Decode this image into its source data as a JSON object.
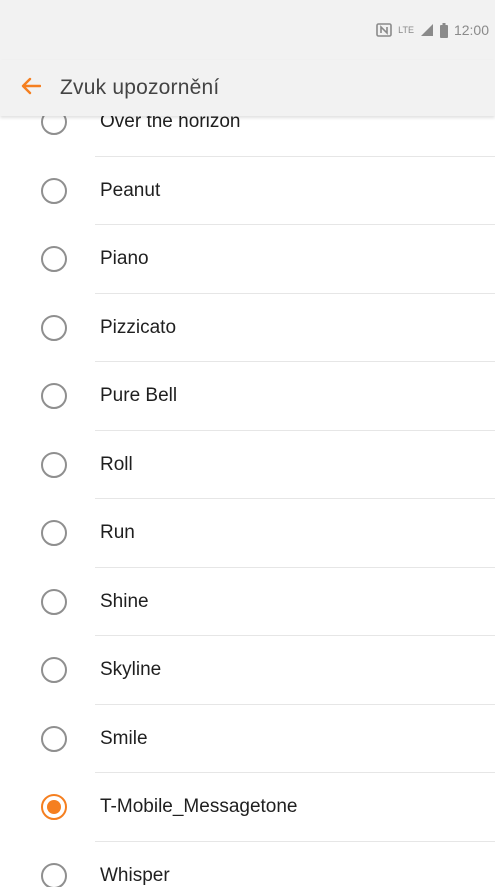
{
  "colors": {
    "accent": "#f57f20",
    "bar_background": "#f2f2f2",
    "radio_unchecked": "#8f8f8f"
  },
  "status_bar": {
    "nfc_icon": "nfc-icon",
    "network_label": "LTE",
    "signal_icon": "signal-icon",
    "battery_icon": "battery-icon",
    "time": "12:00"
  },
  "header": {
    "back_icon": "back-arrow-icon",
    "title": "Zvuk upozornění"
  },
  "list": {
    "items": [
      {
        "label": "Over the horizon",
        "selected": false
      },
      {
        "label": "Peanut",
        "selected": false
      },
      {
        "label": "Piano",
        "selected": false
      },
      {
        "label": "Pizzicato",
        "selected": false
      },
      {
        "label": "Pure Bell",
        "selected": false
      },
      {
        "label": "Roll",
        "selected": false
      },
      {
        "label": "Run",
        "selected": false
      },
      {
        "label": "Shine",
        "selected": false
      },
      {
        "label": "Skyline",
        "selected": false
      },
      {
        "label": "Smile",
        "selected": false
      },
      {
        "label": "T-Mobile_Messagetone",
        "selected": true
      },
      {
        "label": "Whisper",
        "selected": false
      }
    ]
  }
}
